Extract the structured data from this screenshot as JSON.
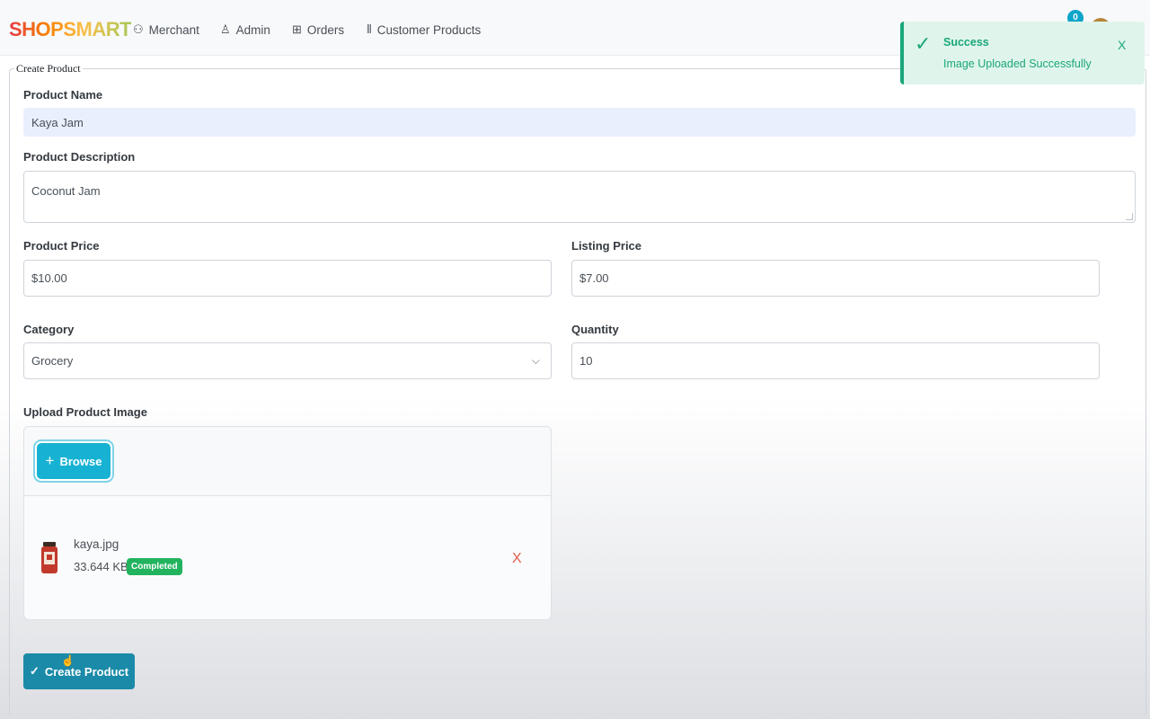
{
  "header": {
    "logo": "SHOPSMART",
    "nav": [
      {
        "label": "Merchant",
        "icon": "merchant-icon",
        "glyph": "⚇"
      },
      {
        "label": "Admin",
        "icon": "user-icon",
        "glyph": "♙"
      },
      {
        "label": "Orders",
        "icon": "gift-icon",
        "glyph": "⊞"
      },
      {
        "label": "Customer Products",
        "icon": "barcode-icon",
        "glyph": "⦀"
      }
    ],
    "notification_count": "0"
  },
  "form": {
    "legend": "Create Product",
    "product_name": {
      "label": "Product Name",
      "value": "Kaya Jam"
    },
    "product_description": {
      "label": "Product Description",
      "value": "Coconut Jam"
    },
    "product_price": {
      "label": "Product Price",
      "value": "$10.00"
    },
    "listing_price": {
      "label": "Listing Price",
      "value": "$7.00"
    },
    "category": {
      "label": "Category",
      "value": "Grocery"
    },
    "quantity": {
      "label": "Quantity",
      "value": "10"
    },
    "upload": {
      "label": "Upload Product Image",
      "browse_label": "Browse",
      "file": {
        "name": "kaya.jpg",
        "size": "33.644 KB",
        "status": "Completed"
      },
      "remove_glyph": "X"
    },
    "submit_label": "Create Product"
  },
  "toast": {
    "title": "Success",
    "message": "Image Uploaded Successfully",
    "close_glyph": "X"
  },
  "colors": {
    "accent": "#17b2d3",
    "primary_button": "#1a8aa8",
    "success": "#1ba67a",
    "badge_green": "#22b35e",
    "danger": "#e05a4e"
  }
}
